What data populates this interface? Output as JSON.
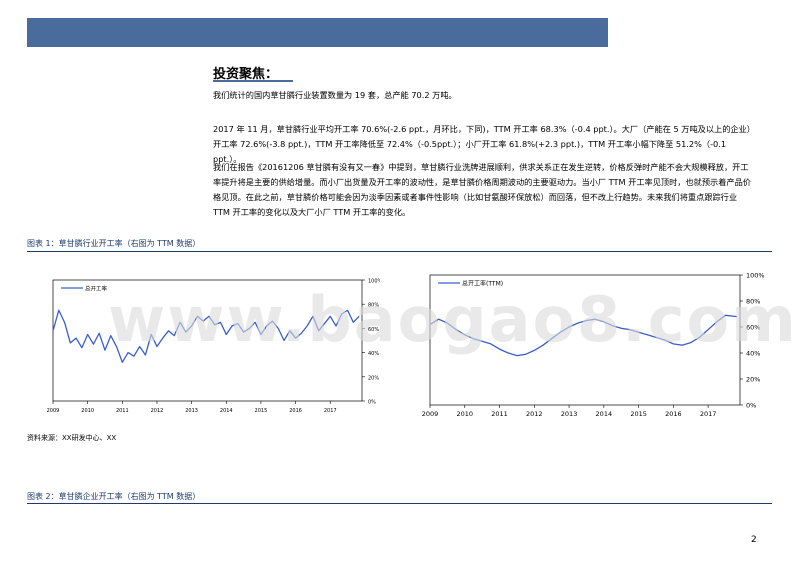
{
  "banner": {
    "color": "#4a6c9c"
  },
  "section_title": "投资聚焦：",
  "paragraphs": {
    "p1": "我们统计的国内草甘膦行业装置数量为 19 套，总产能 70.2 万吨。",
    "p2": "2017 年 11 月，草甘膦行业平均开工率 70.6%(-2.6 ppt.，月环比，下同)，TTM 开工率 68.3%（-0.4 ppt.）。大厂（产能在 5 万吨及以上的企业）开工率 72.6%(-3.8 ppt.)，TTM 开工率降低至 72.4%（-0.5ppt.）；小厂开工率 61.8%(+2.3 ppt.)，TTM 开工率小幅下降至 51.2%（-0.1 ppt.）。",
    "p3": "我们在报告《20161206 草甘膦有没有又一春》中提到，草甘膦行业洗牌进展顺利，供求关系正在发生逆转，价格反弹时产能不会大规模释放，开工率提升将是主要的供给增量。而小厂出货量及开工率的波动性，是草甘膦价格周期波动的主要驱动力。当小厂 TTM 开工率见顶时，也就预示着产品价格见顶。在此之前，草甘膦价格可能会因为淡季因素或者事件性影响（比如甘氨酸环保放松）而回落，但不改上行趋势。未来我们将重点跟踪行业 TTM 开工率的变化以及大厂小厂 TTM 开工率的变化。"
  },
  "captions": {
    "figure1": "图表 1：草甘膦行业开工率（右图为 TTM 数据）",
    "figure2": "图表 2：草甘膦企业开工率（右图为 TTM 数据）"
  },
  "source": "资料来源：XX研发中心、XX",
  "page_number": "2",
  "watermark": "www.baogao8.com",
  "chart_data": [
    {
      "type": "line",
      "title": "",
      "legend": "top-left",
      "series": [
        {
          "name": "总开工率",
          "color": "#3a5fcd",
          "x": [
            "2009-01",
            "2009-03",
            "2009-05",
            "2009-07",
            "2009-09",
            "2009-11",
            "2010-01",
            "2010-03",
            "2010-05",
            "2010-07",
            "2010-09",
            "2010-11",
            "2011-01",
            "2011-03",
            "2011-05",
            "2011-07",
            "2011-09",
            "2011-11",
            "2012-01",
            "2012-03",
            "2012-05",
            "2012-07",
            "2012-09",
            "2012-11",
            "2013-01",
            "2013-03",
            "2013-05",
            "2013-07",
            "2013-09",
            "2013-11",
            "2014-01",
            "2014-03",
            "2014-05",
            "2014-07",
            "2014-09",
            "2014-11",
            "2015-01",
            "2015-03",
            "2015-05",
            "2015-07",
            "2015-09",
            "2015-11",
            "2016-01",
            "2016-03",
            "2016-05",
            "2016-07",
            "2016-09",
            "2016-11",
            "2017-01",
            "2017-03",
            "2017-05",
            "2017-07",
            "2017-09",
            "2017-11"
          ],
          "values": [
            58,
            75,
            65,
            48,
            52,
            44,
            55,
            47,
            56,
            42,
            54,
            45,
            32,
            40,
            37,
            45,
            38,
            55,
            45,
            52,
            58,
            54,
            65,
            57,
            62,
            70,
            66,
            70,
            63,
            65,
            55,
            62,
            64,
            57,
            60,
            65,
            55,
            62,
            66,
            60,
            50,
            58,
            52,
            56,
            62,
            70,
            58,
            64,
            70,
            62,
            72,
            75,
            65,
            70
          ]
        }
      ],
      "x_ticks": [
        "2009",
        "2010",
        "2011",
        "2012",
        "2013",
        "2014",
        "2015",
        "2016",
        "2017"
      ],
      "y_ticks": [
        "0%",
        "20%",
        "40%",
        "60%",
        "80%",
        "100%"
      ],
      "ylim": [
        0,
        100
      ]
    },
    {
      "type": "line",
      "title": "",
      "legend": "top-left",
      "series": [
        {
          "name": "总开工率(TTM)",
          "color": "#3a5fcd",
          "x": [
            "2009-01",
            "2009-04",
            "2009-07",
            "2009-10",
            "2010-01",
            "2010-04",
            "2010-07",
            "2010-10",
            "2011-01",
            "2011-04",
            "2011-07",
            "2011-10",
            "2012-01",
            "2012-04",
            "2012-07",
            "2012-10",
            "2013-01",
            "2013-04",
            "2013-07",
            "2013-10",
            "2014-01",
            "2014-04",
            "2014-07",
            "2014-10",
            "2015-01",
            "2015-04",
            "2015-07",
            "2015-10",
            "2016-01",
            "2016-04",
            "2016-07",
            "2016-10",
            "2017-01",
            "2017-04",
            "2017-07",
            "2017-11"
          ],
          "values": [
            62,
            66,
            63,
            58,
            54,
            51,
            49,
            47,
            43,
            40,
            38,
            39,
            42,
            46,
            51,
            56,
            60,
            63,
            65,
            66,
            64,
            61,
            59,
            58,
            56,
            54,
            52,
            50,
            47,
            46,
            48,
            52,
            58,
            64,
            69,
            68
          ]
        }
      ],
      "x_ticks": [
        "2009",
        "2010",
        "2011",
        "2012",
        "2013",
        "2014",
        "2015",
        "2016",
        "2017"
      ],
      "y_ticks": [
        "0%",
        "20%",
        "40%",
        "60%",
        "80%",
        "100%"
      ],
      "ylim": [
        0,
        100
      ]
    }
  ]
}
